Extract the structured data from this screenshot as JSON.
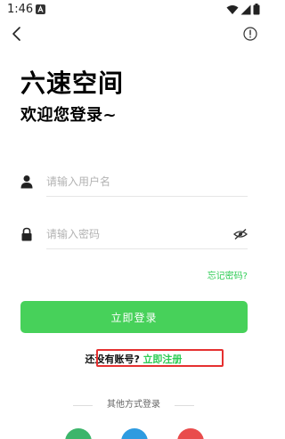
{
  "status_bar": {
    "time": "1:46",
    "notification_icon": "a-notification-icon",
    "icons": [
      "wifi-icon",
      "signal-icon",
      "battery-icon"
    ]
  },
  "nav": {
    "back_icon": "chevron-left-icon",
    "info_icon": "info-circle-icon"
  },
  "header": {
    "title": "六速空间",
    "subtitle": "欢迎您登录~"
  },
  "form": {
    "username": {
      "placeholder": "请输入用户名",
      "value": "",
      "icon": "user-icon"
    },
    "password": {
      "placeholder": "请输入密码",
      "value": "",
      "icon": "lock-icon",
      "toggle_icon": "eye-off-icon"
    },
    "forgot_label": "忘记密码?",
    "login_label": "立即登录"
  },
  "signup": {
    "question": "还没有账号?",
    "link_label": "立即注册",
    "highlight_color": "#e53030"
  },
  "other_login": {
    "label": "其他方式登录",
    "providers": [
      {
        "name": "wechat-icon",
        "color": "#3db56b"
      },
      {
        "name": "qq-icon",
        "color": "#2e9be0"
      },
      {
        "name": "weibo-icon",
        "color": "#e94c4c"
      }
    ]
  },
  "colors": {
    "accent": "#47d15a",
    "link": "#2ecc55"
  }
}
